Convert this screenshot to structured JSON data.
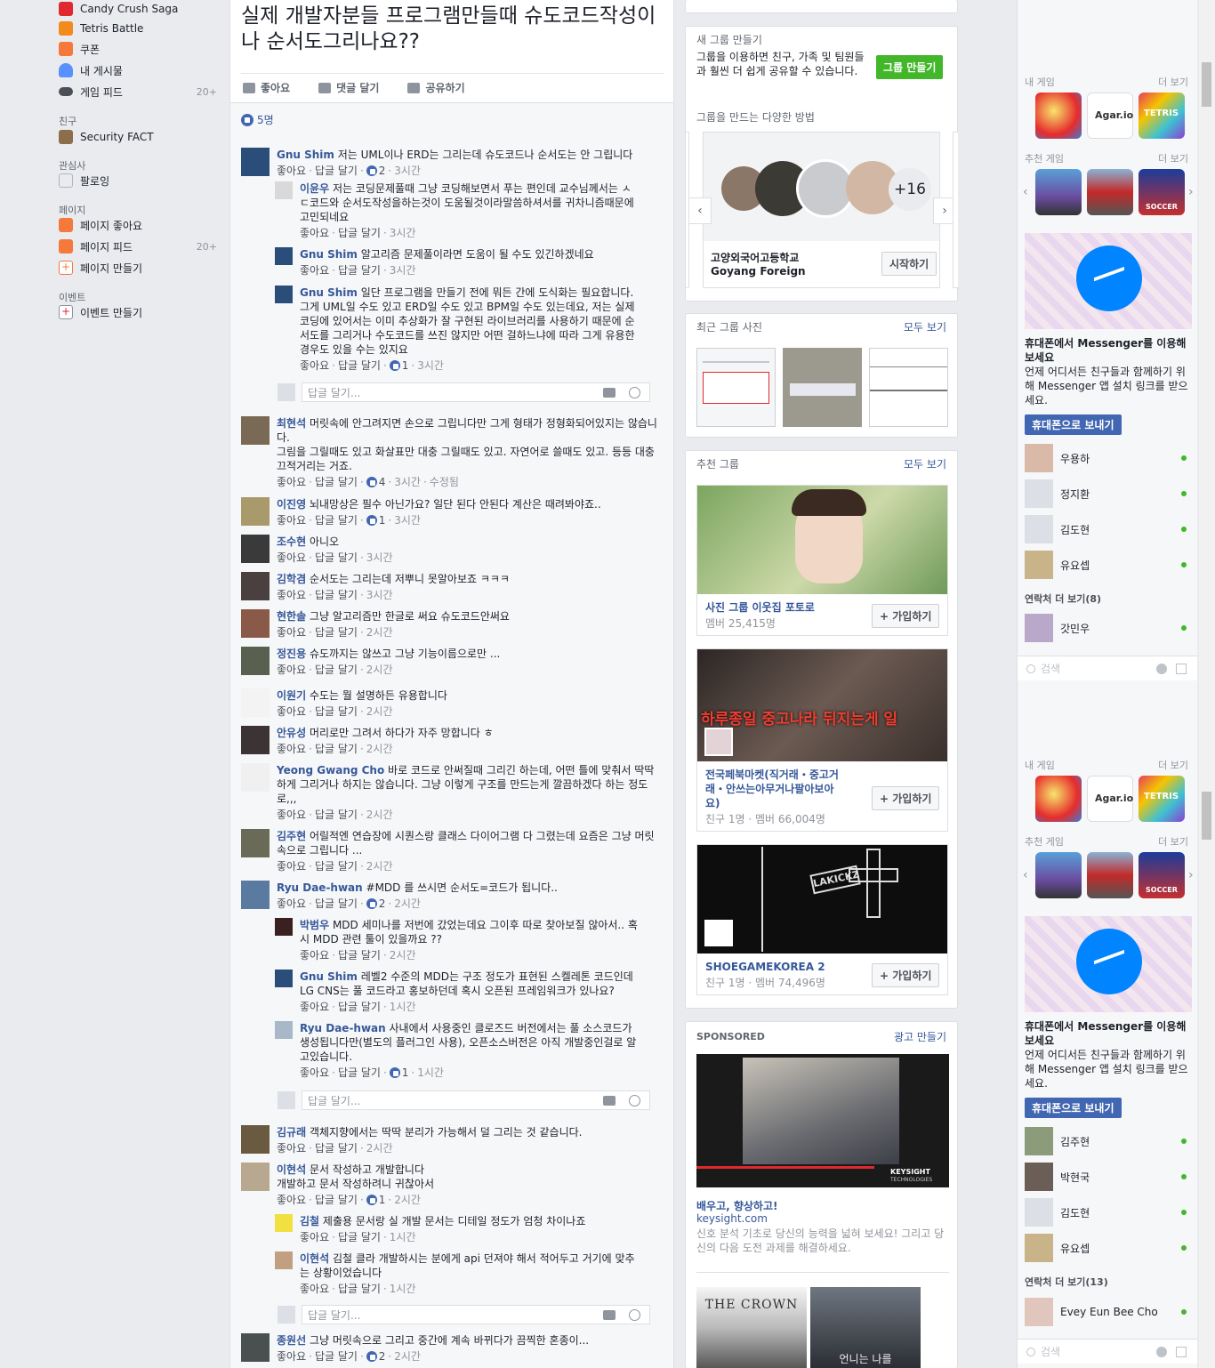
{
  "left_nav": {
    "items": [
      {
        "label": "Candy Crush Saga",
        "icon": "candy-icon",
        "color": "#e0292f"
      },
      {
        "label": "Tetris Battle",
        "icon": "tetris-icon",
        "color": "#f28a1e"
      },
      {
        "label": "쿠폰",
        "icon": "coupon-icon",
        "color": "#f5793b"
      },
      {
        "label": "내 게시물",
        "icon": "person-icon",
        "color": "#5890ff"
      },
      {
        "label": "게임 피드",
        "icon": "gamepad-icon",
        "color": "#4b4f56",
        "count": "20+"
      }
    ],
    "friends_head": "친구",
    "friends": [
      {
        "label": "Security FACT",
        "icon": "list-icon"
      }
    ],
    "interests_head": "관심사",
    "interests": [
      {
        "label": "팔로잉",
        "icon": "rss-icon"
      }
    ],
    "pages_head": "페이지",
    "pages": [
      {
        "label": "페이지 좋아요",
        "icon": "flag-icon"
      },
      {
        "label": "페이지 피드",
        "icon": "feed-icon",
        "count": "20+"
      },
      {
        "label": "페이지 만들기",
        "icon": "plus-icon"
      }
    ],
    "events_head": "이벤트",
    "events": [
      {
        "label": "이벤트 만들기",
        "icon": "calendar-plus-icon"
      }
    ]
  },
  "post": {
    "title": "실제 개발자분들 프로그램만들때 슈도코드작성이나 순서도그리나요??",
    "actions": {
      "like": "좋아요",
      "comment": "댓글 달기",
      "share": "공유하기"
    },
    "likes_count": "5명",
    "reply_placeholder": "답글 달기...",
    "comments": [
      {
        "name": "Gnu Shim",
        "text": "저는 UML이나 ERD는 그리는데 슈도코드나 순서도는 안 그립니다",
        "like": "좋아요",
        "reply": "답글 달기",
        "rx": "2",
        "time": "3시간"
      },
      {
        "name": "이윤우",
        "text": "저는 코딩문제풀때 그냥 코딩해보면서 푸는 편인데 교수님께서는 ㅅㄷ코드와 순서도작성을하는것이 도움될것이라말씀하셔서를 귀차니즘때문에 고민되네요",
        "like": "좋아요",
        "reply": "답글 달기",
        "time": "3시간"
      },
      {
        "name": "Gnu Shim",
        "text": "알고리즘 문제풀이라면 도움이 될 수도 있긴하겠네요",
        "like": "좋아요",
        "reply": "답글 달기",
        "time": "3시간"
      },
      {
        "name": "Gnu Shim",
        "text": "일단 프로그램을 만들기 전에 뭐든 간에 도식화는 필요합니다. 그게 UML일 수도 있고 ERD일 수도 있고 BPM일 수도 있는데요, 저는 실제 코딩에 있어서는 이미 추상화가 잘 구현된 라이브러리를 사용하기 때문에 순서도를 그리거나 수도코드를 쓰진 않지만 어떤 걸하느냐에 따라 그게 유용한 경우도 있을 수는 있지요",
        "like": "좋아요",
        "reply": "답글 달기",
        "rx": "1",
        "time": "3시간"
      },
      {
        "name": "최현석",
        "text": "머릿속에 안그려지면 손으로 그립니다만 그게 형태가 정형화되어있지는 않습니다.\n그림을 그릴때도 있고 화살표만 대충 그릴때도 있고. 자연어로 쓸때도 있고. 등등 대충 끄적거리는 거죠.",
        "like": "좋아요",
        "reply": "답글 달기",
        "rx": "4",
        "time": "3시간",
        "edited": "수정됨"
      },
      {
        "name": "이진영",
        "text": "뇌내망상은 필수 아닌가요? 일단 된다 안된다 계산은 때려봐야죠..",
        "like": "좋아요",
        "reply": "답글 달기",
        "rx": "1",
        "time": "3시간"
      },
      {
        "name": "조수현",
        "text": "아니오",
        "like": "좋아요",
        "reply": "답글 달기",
        "time": "3시간"
      },
      {
        "name": "김학겸",
        "text": "순서도는 그리는데 저뿌니 못알아보죠 ㅋㅋㅋ",
        "like": "좋아요",
        "reply": "답글 달기",
        "time": "3시간"
      },
      {
        "name": "현한솔",
        "text": "그냥 알고리즘만 한글로 써요 슈도코드안써요",
        "like": "좋아요",
        "reply": "답글 달기",
        "time": "2시간"
      },
      {
        "name": "정진용",
        "text": "슈도까지는 않쓰고 그냥 기능이름으로만 ...",
        "like": "좋아요",
        "reply": "답글 달기",
        "time": "2시간"
      },
      {
        "name": "이원기",
        "text": "수도는 뭘 설명하든 유용합니다",
        "like": "좋아요",
        "reply": "답글 달기",
        "time": "2시간"
      },
      {
        "name": "안유성",
        "text": "머리로만 그려서 하다가 자주 망합니다 ㅎ",
        "like": "좋아요",
        "reply": "답글 달기",
        "time": "2시간"
      },
      {
        "name": "Yeong Gwang Cho",
        "text": "바로 코드로 안써질때 그리긴 하는데, 어떤 틀에 맞춰서 딱딱하게 그리거나 하지는 않습니다. 그냥 이렇게 구조를 만드는게 깔끔하겠다 하는 정도로,,,",
        "like": "좋아요",
        "reply": "답글 달기",
        "time": "2시간"
      },
      {
        "name": "김주현",
        "text": "어릴적엔 연습장에 시퀀스랑 클래스 다이어그램 다 그렸는데 요즘은 그냥 머릿속으로 그립니다 ...",
        "like": "좋아요",
        "reply": "답글 달기",
        "time": "2시간"
      },
      {
        "name": "Ryu Dae-hwan",
        "text": "#MDD 를 쓰시면 순서도=코드가 됩니다..",
        "like": "좋아요",
        "reply": "답글 달기",
        "rx": "2",
        "time": "2시간"
      },
      {
        "name": "박범우",
        "text": "MDD 세미나를 저번에 갔었는데요 그이후 따로 찾아보질 않아서.. 혹시 MDD 관련 툴이 있을까요 ??",
        "like": "좋아요",
        "reply": "답글 달기",
        "time": "2시간"
      },
      {
        "name": "Gnu Shim",
        "text": "레벨2 수준의 MDD는 구조 정도가 표현된 스켈레톤 코드인데 LG CNS는 풀 코드라고 홍보하던데 혹시 오픈된 프레임워크가 있나요?",
        "like": "좋아요",
        "reply": "답글 달기",
        "time": "1시간"
      },
      {
        "name": "Ryu Dae-hwan",
        "text": "사내에서 사용중인 클로즈드 버전에서는 풀 소스코드가 생성됩니다만(별도의 플러그인 사용), 오픈소스버전은 아직 개발중인걸로 알고있습니다.",
        "like": "좋아요",
        "reply": "답글 달기",
        "rx": "1",
        "time": "1시간"
      },
      {
        "name": "김규래",
        "text": "객체지향에서는 딱딱 분리가 가능해서 덜 그리는 것 같습니다.",
        "like": "좋아요",
        "reply": "답글 달기",
        "time": "2시간"
      },
      {
        "name": "이현석",
        "text": "문서 작성하고 개발합니다\n개발하고 문서 작성하려니 귀찮아서",
        "like": "좋아요",
        "reply": "답글 달기",
        "rx": "1",
        "time": "2시간"
      },
      {
        "name": "김철",
        "text": "제출용 문서랑 실 개발 문서는 디테일 정도가 엄청 차이나죠",
        "like": "좋아요",
        "reply": "답글 달기",
        "time": "1시간"
      },
      {
        "name": "이현석",
        "text": "김철 클라 개발하시는 분에게 api 던져야 해서 적어두고 거기에 맞추는 상황이었습니다",
        "like": "좋아요",
        "reply": "답글 달기",
        "time": "1시간"
      },
      {
        "name": "종원선",
        "text": "그냥 머릿속으로 그리고 중간에 계속 바뀌다가 끔찍한 혼종이...",
        "like": "좋아요",
        "reply": "답글 달기",
        "rx": "2",
        "time": "2시간"
      }
    ]
  },
  "middle": {
    "new_group": {
      "head": "새 그룹 만들기",
      "desc": "그룹을 이용하면 친구, 가족 및 팀원들과 훨씬 더 쉽게 공유할 수 있습니다.",
      "button": "그룹 만들기",
      "sub_head": "그룹을 만드는 다양한 방법",
      "count_badge": "+16",
      "group_name": "고양외국어고등학교",
      "group_en": "Goyang Foreign",
      "start": "시작하기"
    },
    "recent_photos": {
      "head": "최근 그룹 사진",
      "see_all": "모두 보기"
    },
    "suggested": {
      "head": "추천 그룹",
      "see_all": "모두 보기",
      "join": "+ 가입하기",
      "groups": [
        {
          "name": "사진 그룹 이웃집 포토로",
          "sub": "멤버 25,415명",
          "color": "#6f9a5a"
        },
        {
          "name": "전국페북마켓(직거래・중고거래・안쓰는아무거나팔아보아요)",
          "sub": "친구 1명 · 멤버 66,004명",
          "banner": "하루종일 중고나라 뒤지는게 일",
          "color": "#4a3a36"
        },
        {
          "name": "SHOEGAMEKOREA 2",
          "sub": "친구 1명 · 멤버 74,496명",
          "logo": "LAKICKZ",
          "color": "#111111"
        }
      ]
    },
    "sponsored": {
      "head": "SPONSORED",
      "create": "광고 만들기",
      "title": "배우고, 향상하고!",
      "domain": "keysight.com",
      "desc": "신호 분석 기초로 당신의 능력을 넓혀 보세요! 그리고 당신의 다음 도전 과제를 해결하세요.",
      "brand": "KEYSIGHT",
      "brand_sub": "TECHNOLOGIES",
      "crown": "THE CROWN",
      "poster_text": "언니는 나를"
    }
  },
  "right": {
    "my_games": "내 게임",
    "more": "더 보기",
    "recommended_games": "추천 게임",
    "messenger": {
      "title": "휴대폰에서 Messenger를 이용해 보세요",
      "desc": "언제 어디서든 친구들과 함께하기 위해 Messenger 앱 설치 링크를 받으세요.",
      "button": "휴대폰으로 보내기"
    },
    "contacts1": [
      "우용하",
      "정지환",
      "김도현",
      "유요셉"
    ],
    "more_contacts1": "연락처 더 보기(8)",
    "contact_extra1": "갓민우",
    "contacts2": [
      "김주현",
      "박현국",
      "김도현",
      "유요셉"
    ],
    "more_contacts2": "연락처 더 보기(13)",
    "contact_extra2": "Evey Eun Bee Cho",
    "search_placeholder": "검색",
    "game_icons": {
      "agar": "Agar.io",
      "tetris": "TETRIS",
      "soccer": "SOCCER"
    }
  }
}
